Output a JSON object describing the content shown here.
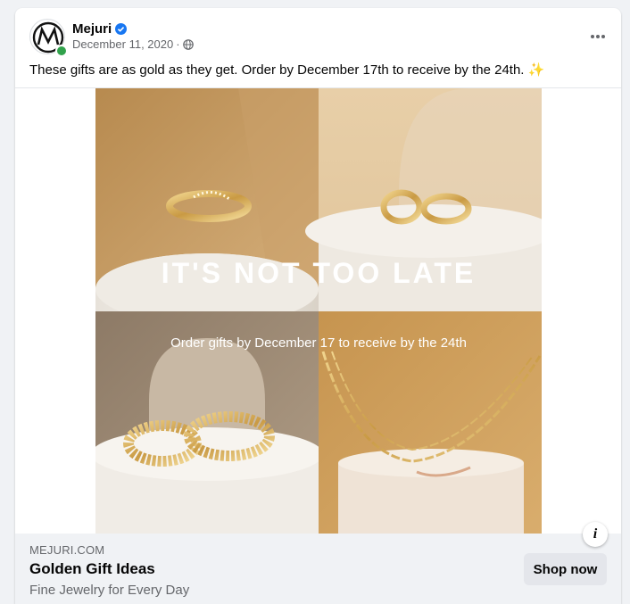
{
  "post": {
    "page_name": "Mejuri",
    "date": "December 11, 2020",
    "meta_separator": "·",
    "caption": "These gifts are as gold as they get. Order by December 17th to receive by the 24th.",
    "caption_emoji": "✨"
  },
  "creative": {
    "headline": "IT'S NOT TOO LATE",
    "subline": "Order gifts by December 17 to receive by the 24th"
  },
  "ad": {
    "domain": "MEJURI.COM",
    "title": "Golden Gift Ideas",
    "description": "Fine Jewelry for Every Day",
    "cta_label": "Shop now",
    "info_label": "i"
  },
  "colors": {
    "verified": "#1877f2",
    "online": "#31a24c",
    "footer_bg": "#f0f2f5",
    "gold": "#d9b25a"
  },
  "icons": [
    "mejuri-logo-icon",
    "verified-badge-icon",
    "globe-icon",
    "more-options-icon",
    "info-icon"
  ]
}
